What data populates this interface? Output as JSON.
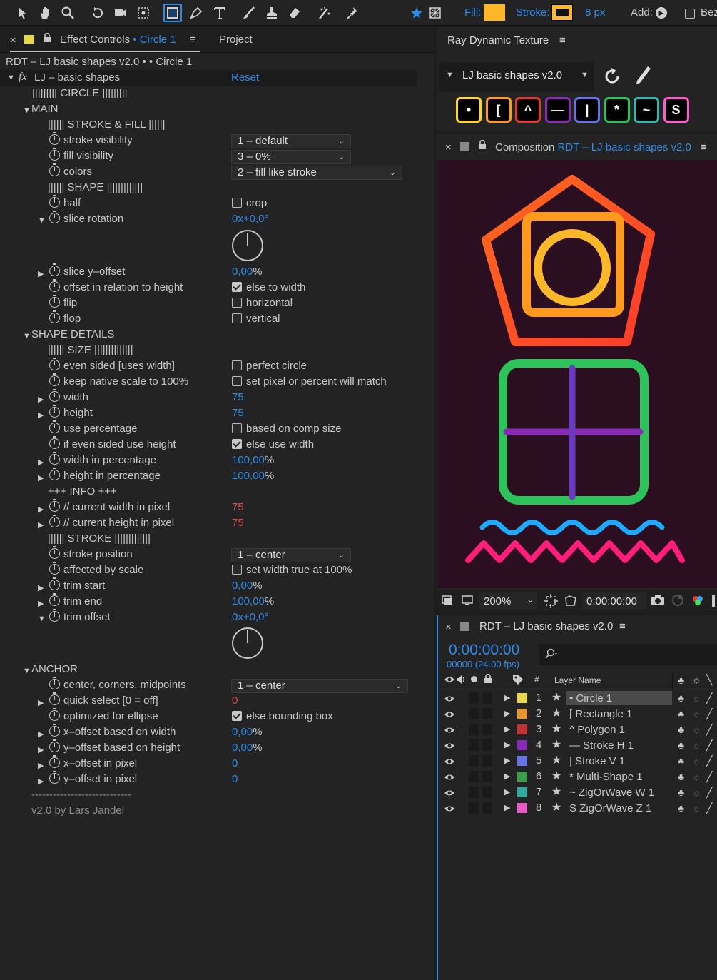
{
  "toolbar": {
    "fill_label": "Fill:",
    "fill_color": "#ffb829",
    "stroke_label": "Stroke:",
    "stroke_color": "#ffb829",
    "stroke_size": "8 px",
    "add_label": "Add:",
    "bezier_label": "Bez"
  },
  "ec": {
    "tab_close": "×",
    "tab_prefix": "Effect Controls",
    "tab_bullet": "•",
    "tab_layer": "Circle 1",
    "tab_menu": "≡",
    "tab_project": "Project",
    "breadcrumb": "RDT – LJ basic shapes v2.0 • • Circle 1",
    "fx": "fx",
    "effect_name": "LJ – basic shapes",
    "reset": "Reset",
    "rows": {
      "circle_header": "||||||||| CIRCLE |||||||||",
      "main": "MAIN",
      "stroke_fill_header": "|||||| STROKE & FILL ||||||",
      "stroke_visibility": "stroke visibility",
      "stroke_visibility_value": "1 – default",
      "fill_visibility": "fill visibility",
      "fill_visibility_value": "3 – 0%",
      "colors": "colors",
      "colors_value": "2 – fill like stroke",
      "shape_header": "|||||| SHAPE |||||||||||||",
      "half": "half",
      "half_value": "crop",
      "slice_rotation": "slice rotation",
      "slice_rotation_value_a": "0x",
      "slice_rotation_value_b": "+0,0°",
      "slice_y_offset": "slice y–offset",
      "slice_y_offset_value": "0,00",
      "pct": "%",
      "offset_rel_height": "offset in relation to height",
      "offset_rel_height_value": "else to width",
      "flip": "flip",
      "flip_value": "horizontal",
      "flop": "flop",
      "flop_value": "vertical",
      "shape_details": "SHAPE DETAILS",
      "size_header": "|||||| SIZE ||||||||||||||",
      "even_sided": "even sided [uses width]",
      "even_sided_value": "perfect circle",
      "keep_native": "keep native scale to 100%",
      "keep_native_value": "set pixel or percent will match",
      "width": "width",
      "width_value": "75",
      "height": "height",
      "height_value": "75",
      "use_percentage": "use percentage",
      "use_percentage_value": "based on comp size",
      "if_even_sided": "if even sided use height",
      "if_even_sided_value": "else use width",
      "width_pct": "width in percentage",
      "width_pct_value": "100,00",
      "height_pct": "height in percentage",
      "height_pct_value": "100,00",
      "info_header": "+++ INFO +++",
      "cur_width": "// current width in pixel",
      "cur_width_value": "75",
      "cur_height": "// current height in pixel",
      "cur_height_value": "75",
      "stroke_header": "|||||| STROKE |||||||||||||",
      "stroke_position": "stroke position",
      "stroke_position_value": "1 – center",
      "affected_by_scale": "affected by scale",
      "affected_by_scale_value": "set width true at 100%",
      "trim_start": "trim start",
      "trim_start_value": "0,00",
      "trim_end": "trim end",
      "trim_end_value": "100,00",
      "trim_offset": "trim offset",
      "trim_offset_value_a": "0x",
      "trim_offset_value_b": "+0,0°",
      "anchor": "ANCHOR",
      "center_corners": "center, corners, midpoints",
      "center_corners_value": "1 – center",
      "quick_select": "quick select [0 = off]",
      "quick_select_value": "0",
      "optimized_ellipse": "optimized for ellipse",
      "optimized_ellipse_value": "else bounding box",
      "x_offset_width": "x–offset based on width",
      "x_offset_width_value": "0,00",
      "y_offset_height": "y–offset based on height",
      "y_offset_height_value": "0,00",
      "x_offset_pixel": "x–offset in pixel",
      "x_offset_pixel_value": "0",
      "y_offset_pixel": "y–offset in pixel",
      "y_offset_pixel_value": "0",
      "separator": "----------------------------",
      "credit": "v2.0 by Lars Jandel"
    }
  },
  "rdt": {
    "title": "Ray Dynamic Texture",
    "menu": "≡",
    "preset": "LJ basic shapes v2.0",
    "buttons": [
      {
        "glyph": "•",
        "color": "#ffd629"
      },
      {
        "glyph": "[",
        "color": "#ff9a1e"
      },
      {
        "glyph": "^",
        "color": "#e03b2e"
      },
      {
        "glyph": "—",
        "color": "#8a2bb8"
      },
      {
        "glyph": "|",
        "color": "#6673e8"
      },
      {
        "glyph": "*",
        "color": "#2ec25a"
      },
      {
        "glyph": "~",
        "color": "#2eb8b0"
      },
      {
        "glyph": "S",
        "color": "#ff5ad0"
      }
    ]
  },
  "comp": {
    "close": "×",
    "title_prefix": "Composition",
    "title_name": "RDT – LJ basic shapes v2.0",
    "menu": "≡",
    "zoom": "200%",
    "timecode": "0:00:00:00"
  },
  "timeline": {
    "close": "×",
    "title": "RDT – LJ basic shapes v2.0",
    "menu": "≡",
    "timecode": "0:00:00:00",
    "frames": "00000 (24.00 fps)",
    "col_hash": "#",
    "col_layer_name": "Layer Name",
    "layers": [
      {
        "num": "1",
        "name": "• Circle 1",
        "color": "#e8d84a",
        "selected": true
      },
      {
        "num": "2",
        "name": "[ Rectangle 1",
        "color": "#e8962a",
        "selected": false
      },
      {
        "num": "3",
        "name": "^ Polygon 1",
        "color": "#c23232",
        "selected": false
      },
      {
        "num": "4",
        "name": "— Stroke H 1",
        "color": "#8a2bb8",
        "selected": false
      },
      {
        "num": "5",
        "name": "| Stroke V 1",
        "color": "#6673e8",
        "selected": false
      },
      {
        "num": "6",
        "name": "* Multi-Shape 1",
        "color": "#3aa04a",
        "selected": false
      },
      {
        "num": "7",
        "name": "~ ZigOrWave W 1",
        "color": "#2eaaa0",
        "selected": false
      },
      {
        "num": "8",
        "name": "S ZigOrWave Z 1",
        "color": "#e85ac8",
        "selected": false
      }
    ]
  }
}
